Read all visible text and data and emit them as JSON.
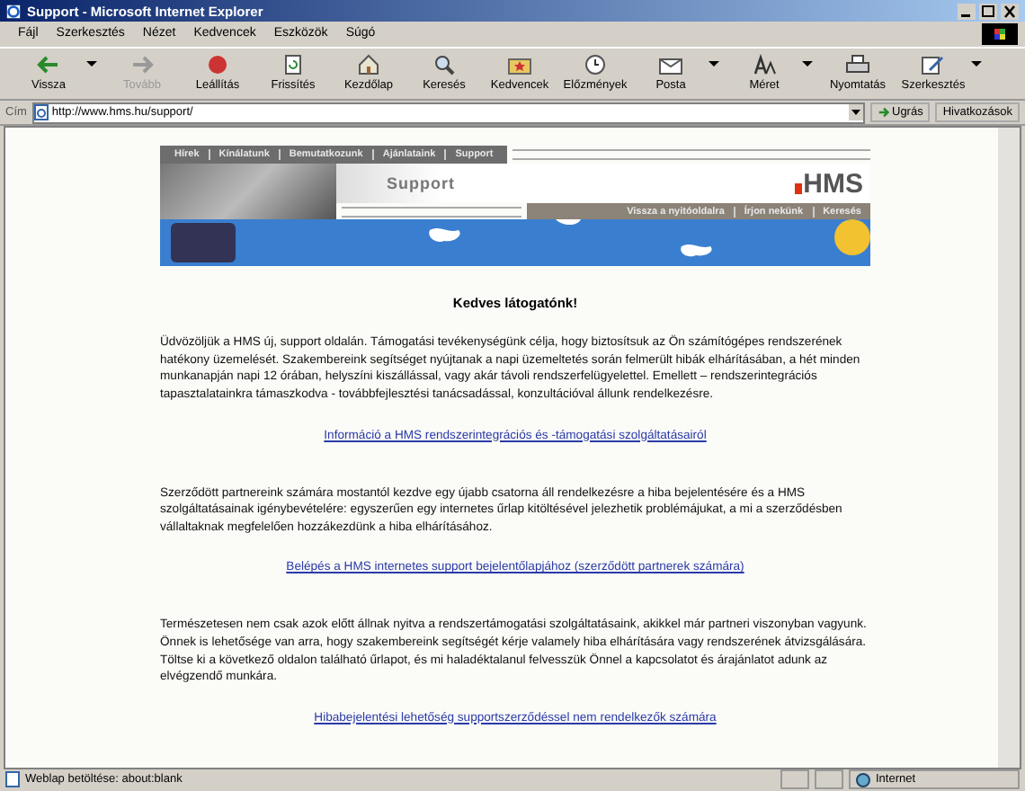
{
  "window": {
    "title": "Support - Microsoft Internet Explorer"
  },
  "menu": [
    "Fájl",
    "Szerkesztés",
    "Nézet",
    "Kedvencek",
    "Eszközök",
    "Súgó"
  ],
  "toolbar": [
    {
      "kind": "back",
      "label": "Vissza",
      "dropdown": true,
      "disabled": false
    },
    {
      "kind": "forward",
      "label": "Tovább",
      "dropdown": false,
      "disabled": true
    },
    {
      "kind": "stop",
      "label": "Leállítás",
      "dropdown": false,
      "disabled": false
    },
    {
      "kind": "refresh",
      "label": "Frissítés",
      "dropdown": false,
      "disabled": false
    },
    {
      "kind": "home",
      "label": "Kezdőlap",
      "dropdown": false,
      "disabled": false
    },
    {
      "kind": "search",
      "label": "Keresés",
      "dropdown": false,
      "disabled": false
    },
    {
      "kind": "favorites",
      "label": "Kedvencek",
      "dropdown": false,
      "disabled": false
    },
    {
      "kind": "history",
      "label": "Előzmények",
      "dropdown": false,
      "disabled": false
    },
    {
      "kind": "mail",
      "label": "Posta",
      "dropdown": true,
      "disabled": false
    },
    {
      "kind": "size",
      "label": "Méret",
      "dropdown": true,
      "disabled": false
    },
    {
      "kind": "print",
      "label": "Nyomtatás",
      "dropdown": false,
      "disabled": false
    },
    {
      "kind": "edit",
      "label": "Szerkesztés",
      "dropdown": true,
      "disabled": false
    }
  ],
  "address": {
    "label": "Cím",
    "url": "http://www.hms.hu/support/",
    "go": "Ugrás",
    "links": "Hivatkozások"
  },
  "page": {
    "nav": [
      "Hírek",
      "Kínálatunk",
      "Bemutatkozunk",
      "Ajánlataink",
      "Support"
    ],
    "title": "Support",
    "logo": "HMS",
    "subnav": [
      "Vissza a nyitóoldalra",
      "Írjon nekünk",
      "Keresés"
    ],
    "heading": "Kedves látogatónk!",
    "sections": [
      {
        "paragraph": "Üdvözöljük a HMS új, support oldalán. Támogatási tevékenységünk célja, hogy biztosítsuk az Ön számítógépes rendszerének hatékony üzemelését. Szakembereink segítséget nyújtanak a napi üzemeltetés során felmerült hibák elhárításában, a hét minden munkanapján napi 12 órában, helyszíni kiszállással, vagy akár távoli rendszerfelügyelettel. Emellett – rendszerintegrációs tapasztalatainkra támaszkodva - továbbfejlesztési tanácsadással, konzultációval állunk rendelkezésre.",
        "link": "Információ a HMS rendszerintegrációs és -támogatási szolgáltatásairól"
      },
      {
        "paragraph": "Szerződött partnereink számára mostantól kezdve egy újabb csatorna áll rendelkezésre a hiba bejelentésére és a HMS szolgáltatásainak igénybevételére: egyszerűen egy internetes űrlap kitöltésével jelezhetik problémájukat, a mi a szerződésben vállaltaknak megfelelően hozzákezdünk a hiba elhárításához.",
        "link": "Belépés a HMS internetes support bejelentőlapjához (szerződött partnerek számára)"
      },
      {
        "paragraph": "Természetesen nem csak azok előtt állnak nyitva a rendszertámogatási szolgáltatásaink, akikkel már partneri viszonyban vagyunk. Önnek is lehetősége van arra, hogy szakembereink segítségét kérje valamely hiba elhárítására vagy rendszerének átvizsgálására. Töltse ki a következő oldalon található űrlapot, és mi haladéktalanul felvesszük Önnel a kapcsolatot és árajánlatot adunk az elvégzendő munkára.",
        "link": "Hibabejelentési lehetőség supportszerződéssel nem rendelkezők számára"
      }
    ]
  },
  "status_bar": {
    "text": "Weblap betöltése: about:blank",
    "zone": "Internet"
  }
}
